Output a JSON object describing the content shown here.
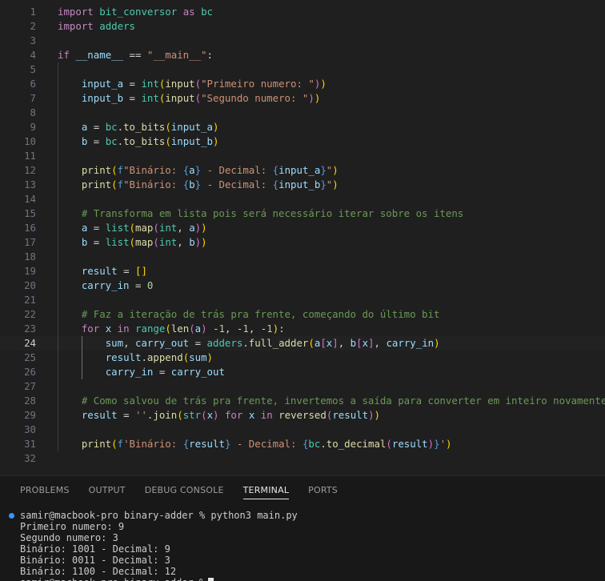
{
  "editor": {
    "current_line": 24,
    "lines": [
      {
        "n": "1",
        "tokens": [
          [
            "kw",
            "import"
          ],
          [
            "op",
            " "
          ],
          [
            "mod",
            "bit_conversor"
          ],
          [
            "op",
            " "
          ],
          [
            "kw",
            "as"
          ],
          [
            "op",
            " "
          ],
          [
            "mod",
            "bc"
          ]
        ]
      },
      {
        "n": "2",
        "tokens": [
          [
            "kw",
            "import"
          ],
          [
            "op",
            " "
          ],
          [
            "mod",
            "adders"
          ]
        ]
      },
      {
        "n": "3",
        "tokens": []
      },
      {
        "n": "4",
        "tokens": [
          [
            "ctl",
            "if"
          ],
          [
            "op",
            " "
          ],
          [
            "var",
            "__name__"
          ],
          [
            "op",
            " == "
          ],
          [
            "str",
            "\"__main__\""
          ],
          [
            "op",
            ":"
          ]
        ]
      },
      {
        "n": "5",
        "tokens": []
      },
      {
        "n": "6",
        "tokens": [
          [
            "op",
            "    "
          ],
          [
            "var",
            "input_a"
          ],
          [
            "op",
            " = "
          ],
          [
            "cls",
            "int"
          ],
          [
            "p1",
            "("
          ],
          [
            "fn",
            "input"
          ],
          [
            "p2",
            "("
          ],
          [
            "str",
            "\"Primeiro numero: \""
          ],
          [
            "p2",
            ")"
          ],
          [
            "p1",
            ")"
          ]
        ]
      },
      {
        "n": "7",
        "tokens": [
          [
            "op",
            "    "
          ],
          [
            "var",
            "input_b"
          ],
          [
            "op",
            " = "
          ],
          [
            "cls",
            "int"
          ],
          [
            "p1",
            "("
          ],
          [
            "fn",
            "input"
          ],
          [
            "p2",
            "("
          ],
          [
            "str",
            "\"Segundo numero: \""
          ],
          [
            "p2",
            ")"
          ],
          [
            "p1",
            ")"
          ]
        ]
      },
      {
        "n": "8",
        "tokens": []
      },
      {
        "n": "9",
        "tokens": [
          [
            "op",
            "    "
          ],
          [
            "var",
            "a"
          ],
          [
            "op",
            " = "
          ],
          [
            "mod",
            "bc"
          ],
          [
            "op",
            "."
          ],
          [
            "fn",
            "to_bits"
          ],
          [
            "p1",
            "("
          ],
          [
            "var",
            "input_a"
          ],
          [
            "p1",
            ")"
          ]
        ]
      },
      {
        "n": "10",
        "tokens": [
          [
            "op",
            "    "
          ],
          [
            "var",
            "b"
          ],
          [
            "op",
            " = "
          ],
          [
            "mod",
            "bc"
          ],
          [
            "op",
            "."
          ],
          [
            "fn",
            "to_bits"
          ],
          [
            "p1",
            "("
          ],
          [
            "var",
            "input_b"
          ],
          [
            "p1",
            ")"
          ]
        ]
      },
      {
        "n": "11",
        "tokens": []
      },
      {
        "n": "12",
        "tokens": [
          [
            "op",
            "    "
          ],
          [
            "fn",
            "print"
          ],
          [
            "p1",
            "("
          ],
          [
            "fp",
            "f"
          ],
          [
            "str",
            "\"Binário: "
          ],
          [
            "fp",
            "{"
          ],
          [
            "var",
            "a"
          ],
          [
            "fp",
            "}"
          ],
          [
            "str",
            " - Decimal: "
          ],
          [
            "fp",
            "{"
          ],
          [
            "var",
            "input_a"
          ],
          [
            "fp",
            "}"
          ],
          [
            "str",
            "\""
          ],
          [
            "p1",
            ")"
          ]
        ]
      },
      {
        "n": "13",
        "tokens": [
          [
            "op",
            "    "
          ],
          [
            "fn",
            "print"
          ],
          [
            "p1",
            "("
          ],
          [
            "fp",
            "f"
          ],
          [
            "str",
            "\"Binário: "
          ],
          [
            "fp",
            "{"
          ],
          [
            "var",
            "b"
          ],
          [
            "fp",
            "}"
          ],
          [
            "str",
            " - Decimal: "
          ],
          [
            "fp",
            "{"
          ],
          [
            "var",
            "input_b"
          ],
          [
            "fp",
            "}"
          ],
          [
            "str",
            "\""
          ],
          [
            "p1",
            ")"
          ]
        ]
      },
      {
        "n": "14",
        "tokens": []
      },
      {
        "n": "15",
        "tokens": [
          [
            "op",
            "    "
          ],
          [
            "com",
            "# Transforma em lista pois será necessário iterar sobre os itens"
          ]
        ]
      },
      {
        "n": "16",
        "tokens": [
          [
            "op",
            "    "
          ],
          [
            "var",
            "a"
          ],
          [
            "op",
            " = "
          ],
          [
            "cls",
            "list"
          ],
          [
            "p1",
            "("
          ],
          [
            "fn",
            "map"
          ],
          [
            "p2",
            "("
          ],
          [
            "cls",
            "int"
          ],
          [
            "op",
            ", "
          ],
          [
            "var",
            "a"
          ],
          [
            "p2",
            ")"
          ],
          [
            "p1",
            ")"
          ]
        ]
      },
      {
        "n": "17",
        "tokens": [
          [
            "op",
            "    "
          ],
          [
            "var",
            "b"
          ],
          [
            "op",
            " = "
          ],
          [
            "cls",
            "list"
          ],
          [
            "p1",
            "("
          ],
          [
            "fn",
            "map"
          ],
          [
            "p2",
            "("
          ],
          [
            "cls",
            "int"
          ],
          [
            "op",
            ", "
          ],
          [
            "var",
            "b"
          ],
          [
            "p2",
            ")"
          ],
          [
            "p1",
            ")"
          ]
        ]
      },
      {
        "n": "18",
        "tokens": []
      },
      {
        "n": "19",
        "tokens": [
          [
            "op",
            "    "
          ],
          [
            "var",
            "result"
          ],
          [
            "op",
            " = "
          ],
          [
            "p1",
            "[]"
          ]
        ]
      },
      {
        "n": "20",
        "tokens": [
          [
            "op",
            "    "
          ],
          [
            "var",
            "carry_in"
          ],
          [
            "op",
            " = "
          ],
          [
            "num",
            "0"
          ]
        ]
      },
      {
        "n": "21",
        "tokens": []
      },
      {
        "n": "22",
        "tokens": [
          [
            "op",
            "    "
          ],
          [
            "com",
            "# Faz a iteração de trás pra frente, começando do último bit"
          ]
        ]
      },
      {
        "n": "23",
        "tokens": [
          [
            "op",
            "    "
          ],
          [
            "ctl",
            "for"
          ],
          [
            "op",
            " "
          ],
          [
            "var",
            "x"
          ],
          [
            "op",
            " "
          ],
          [
            "ctl",
            "in"
          ],
          [
            "op",
            " "
          ],
          [
            "cls",
            "range"
          ],
          [
            "p1",
            "("
          ],
          [
            "fn",
            "len"
          ],
          [
            "p2",
            "("
          ],
          [
            "var",
            "a"
          ],
          [
            "p2",
            ")"
          ],
          [
            "op",
            " -"
          ],
          [
            "num",
            "1"
          ],
          [
            "op",
            ", -"
          ],
          [
            "num",
            "1"
          ],
          [
            "op",
            ", -"
          ],
          [
            "num",
            "1"
          ],
          [
            "p1",
            ")"
          ],
          [
            "op",
            ":"
          ]
        ]
      },
      {
        "n": "24",
        "tokens": [
          [
            "op",
            "        "
          ],
          [
            "var",
            "sum"
          ],
          [
            "op",
            ", "
          ],
          [
            "var",
            "carry_out"
          ],
          [
            "op",
            " = "
          ],
          [
            "mod",
            "adders"
          ],
          [
            "op",
            "."
          ],
          [
            "fn",
            "full_adder"
          ],
          [
            "p1",
            "("
          ],
          [
            "var",
            "a"
          ],
          [
            "p2",
            "["
          ],
          [
            "var",
            "x"
          ],
          [
            "p2",
            "]"
          ],
          [
            "op",
            ", "
          ],
          [
            "var",
            "b"
          ],
          [
            "p2",
            "["
          ],
          [
            "var",
            "x"
          ],
          [
            "p2",
            "]"
          ],
          [
            "op",
            ", "
          ],
          [
            "var",
            "carry_in"
          ],
          [
            "p1",
            ")"
          ]
        ]
      },
      {
        "n": "25",
        "tokens": [
          [
            "op",
            "        "
          ],
          [
            "var",
            "result"
          ],
          [
            "op",
            "."
          ],
          [
            "fn",
            "append"
          ],
          [
            "p1",
            "("
          ],
          [
            "var",
            "sum"
          ],
          [
            "p1",
            ")"
          ]
        ]
      },
      {
        "n": "26",
        "tokens": [
          [
            "op",
            "        "
          ],
          [
            "var",
            "carry_in"
          ],
          [
            "op",
            " = "
          ],
          [
            "var",
            "carry_out"
          ]
        ]
      },
      {
        "n": "27",
        "tokens": []
      },
      {
        "n": "28",
        "tokens": [
          [
            "op",
            "    "
          ],
          [
            "com",
            "# Como salvou de trás pra frente, invertemos a saída para converter em inteiro novamente"
          ]
        ]
      },
      {
        "n": "29",
        "tokens": [
          [
            "op",
            "    "
          ],
          [
            "var",
            "result"
          ],
          [
            "op",
            " = "
          ],
          [
            "str",
            "''"
          ],
          [
            "op",
            "."
          ],
          [
            "fn",
            "join"
          ],
          [
            "p1",
            "("
          ],
          [
            "cls",
            "str"
          ],
          [
            "p2",
            "("
          ],
          [
            "var",
            "x"
          ],
          [
            "p2",
            ")"
          ],
          [
            "op",
            " "
          ],
          [
            "ctl",
            "for"
          ],
          [
            "op",
            " "
          ],
          [
            "var",
            "x"
          ],
          [
            "op",
            " "
          ],
          [
            "ctl",
            "in"
          ],
          [
            "op",
            " "
          ],
          [
            "fn",
            "reversed"
          ],
          [
            "p2",
            "("
          ],
          [
            "var",
            "result"
          ],
          [
            "p2",
            ")"
          ],
          [
            "p1",
            ")"
          ]
        ]
      },
      {
        "n": "30",
        "tokens": []
      },
      {
        "n": "31",
        "tokens": [
          [
            "op",
            "    "
          ],
          [
            "fn",
            "print"
          ],
          [
            "p1",
            "("
          ],
          [
            "fp",
            "f"
          ],
          [
            "str",
            "'Binário: "
          ],
          [
            "fp",
            "{"
          ],
          [
            "var",
            "result"
          ],
          [
            "fp",
            "}"
          ],
          [
            "str",
            " - Decimal: "
          ],
          [
            "fp",
            "{"
          ],
          [
            "mod",
            "bc"
          ],
          [
            "op",
            "."
          ],
          [
            "fn",
            "to_decimal"
          ],
          [
            "p2",
            "("
          ],
          [
            "var",
            "result"
          ],
          [
            "p2",
            ")"
          ],
          [
            "fp",
            "}"
          ],
          [
            "str",
            "'"
          ],
          [
            "p1",
            ")"
          ]
        ]
      },
      {
        "n": "32",
        "tokens": []
      }
    ]
  },
  "panel": {
    "tabs": [
      {
        "label": "PROBLEMS",
        "active": false
      },
      {
        "label": "OUTPUT",
        "active": false
      },
      {
        "label": "DEBUG CONSOLE",
        "active": false
      },
      {
        "label": "TERMINAL",
        "active": true
      },
      {
        "label": "PORTS",
        "active": false
      }
    ],
    "terminal": {
      "prompt": "samir@macbook-pro binary-adder % python3 main.py",
      "lines": [
        "Primeiro numero: 9",
        "Segundo numero: 3",
        "Binário: 1001 - Decimal: 9",
        "Binário: 0011 - Decimal: 3",
        "Binário: 1100 - Decimal: 12"
      ],
      "next_prompt": "samir@macbook-pro binary-adder %"
    }
  },
  "colors": {
    "background": "#1f1f1f",
    "panel": "#181818",
    "comment": "#6a9955",
    "string": "#ce9178",
    "keyword": "#c586c0",
    "variable": "#9cdcfe",
    "function": "#dcdcaa",
    "module": "#4ec9b0",
    "terminal_dot": "#3794ff"
  }
}
